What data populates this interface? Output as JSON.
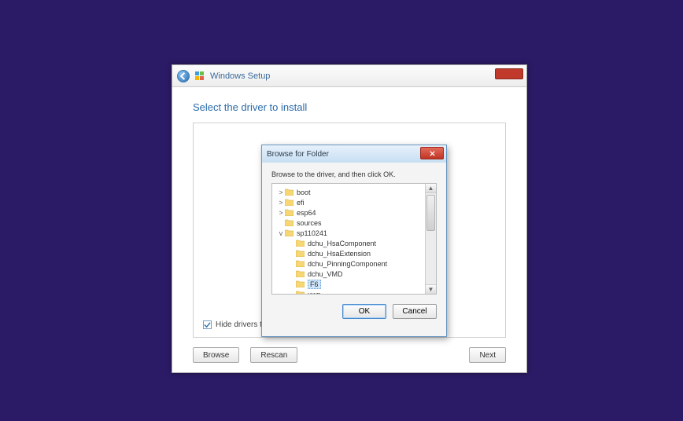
{
  "main_window": {
    "title": "Windows Setup",
    "heading": "Select the driver to install",
    "hide_drivers_label": "Hide drivers th",
    "hide_drivers_checked": true,
    "buttons": {
      "browse": "Browse",
      "rescan": "Rescan",
      "next": "Next"
    }
  },
  "dialog": {
    "title": "Browse for Folder",
    "instruction": "Browse to the driver, and then click OK.",
    "buttons": {
      "ok": "OK",
      "cancel": "Cancel"
    },
    "tree": [
      {
        "indent": 0,
        "expander": ">",
        "label": "boot",
        "selected": false
      },
      {
        "indent": 0,
        "expander": ">",
        "label": "efi",
        "selected": false
      },
      {
        "indent": 0,
        "expander": ">",
        "label": "esp64",
        "selected": false
      },
      {
        "indent": 0,
        "expander": "",
        "label": "sources",
        "selected": false
      },
      {
        "indent": 0,
        "expander": "v",
        "label": "sp110241",
        "selected": false
      },
      {
        "indent": 1,
        "expander": "",
        "label": "dchu_HsaComponent",
        "selected": false
      },
      {
        "indent": 1,
        "expander": "",
        "label": "dchu_HsaExtension",
        "selected": false
      },
      {
        "indent": 1,
        "expander": "",
        "label": "dchu_PinningComponent",
        "selected": false
      },
      {
        "indent": 1,
        "expander": "",
        "label": "dchu_VMD",
        "selected": false
      },
      {
        "indent": 1,
        "expander": "",
        "label": "F6",
        "selected": true
      },
      {
        "indent": 1,
        "expander": "",
        "label": "uwp",
        "selected": false
      }
    ]
  }
}
